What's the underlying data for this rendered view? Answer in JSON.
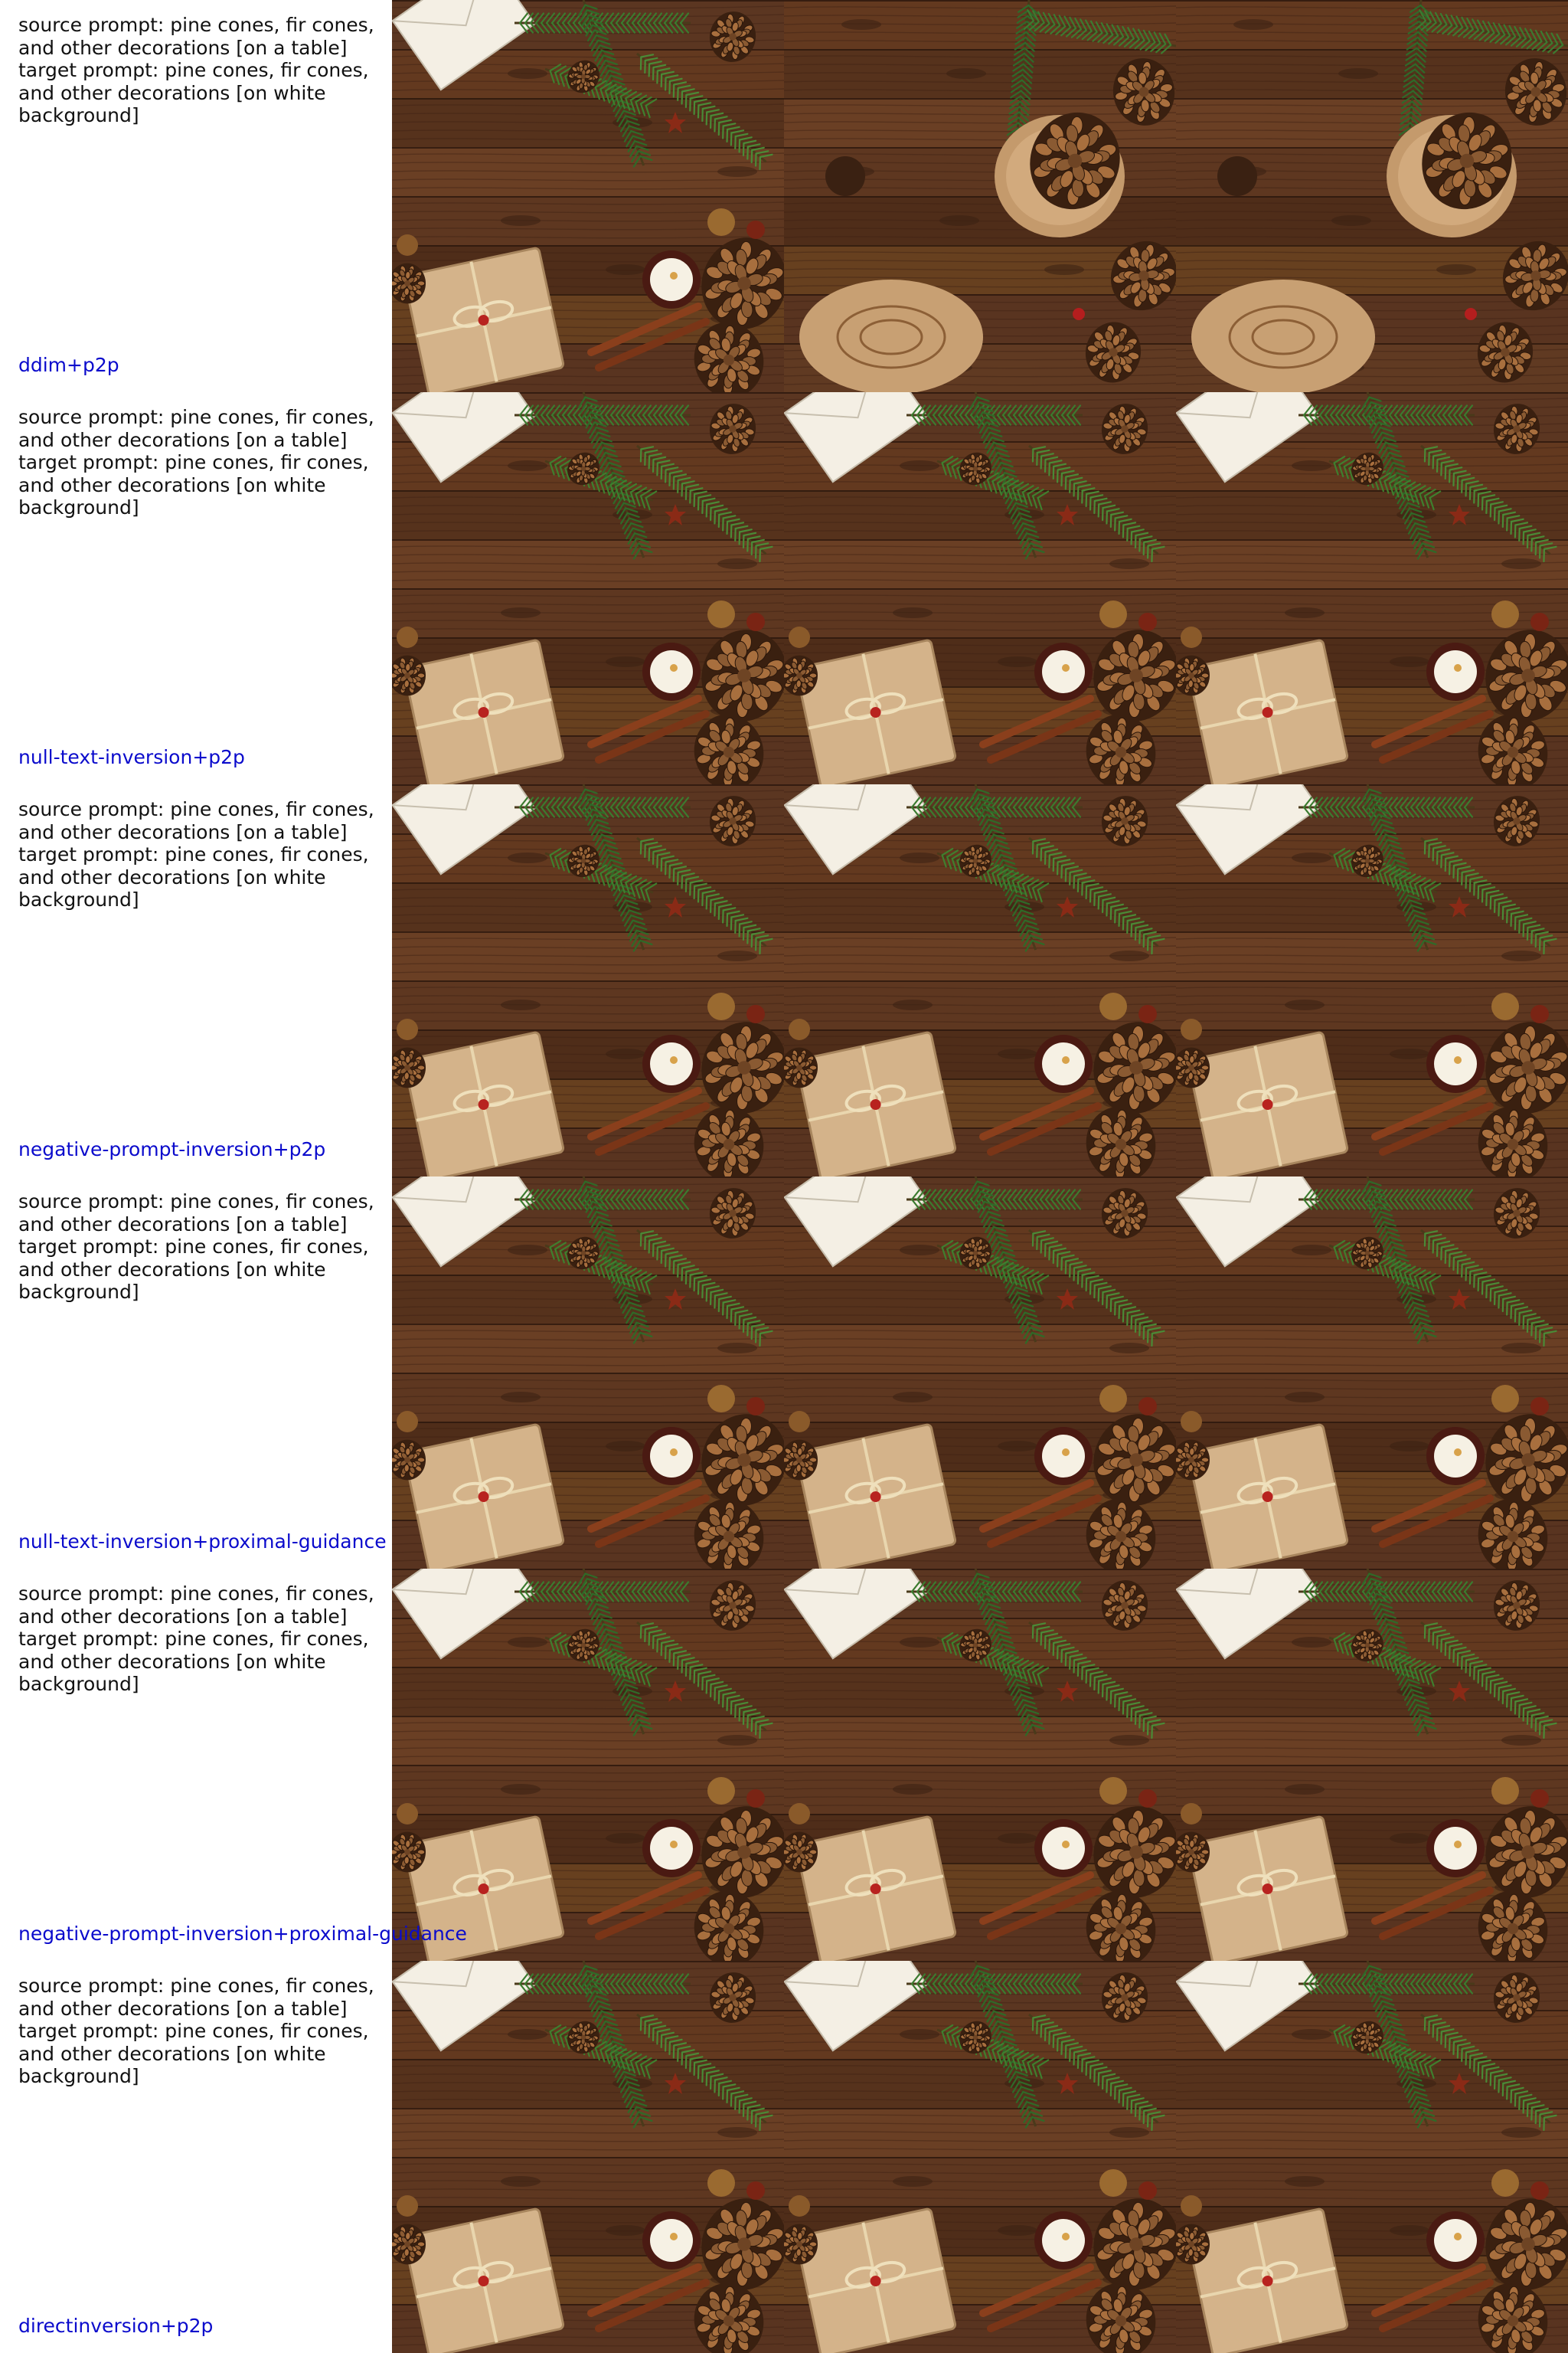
{
  "colors": {
    "method_label": "#0b0bcc",
    "prompt_text": "#111111",
    "background": "#ffffff"
  },
  "rows": [
    {
      "prompt": "source prompt: pine cones, fir cones,\nand other decorations [on a table]\ntarget prompt: pine cones, fir cones,\nand other decorations [on white\nbackground]",
      "method": "ddim+p2p"
    },
    {
      "prompt": "source prompt: pine cones, fir cones,\nand other decorations [on a table]\ntarget prompt: pine cones, fir cones,\nand other decorations [on white\nbackground]",
      "method": "null-text-inversion+p2p"
    },
    {
      "prompt": "source prompt: pine cones, fir cones,\nand other decorations [on a table]\ntarget prompt: pine cones, fir cones,\nand other decorations [on white\nbackground]",
      "method": "negative-prompt-inversion+p2p"
    },
    {
      "prompt": "source prompt: pine cones, fir cones,\nand other decorations [on a table]\ntarget prompt: pine cones, fir cones,\nand other decorations [on white\nbackground]",
      "method": "null-text-inversion+proximal-guidance"
    },
    {
      "prompt": "source prompt: pine cones, fir cones,\nand other decorations [on a table]\ntarget prompt: pine cones, fir cones,\nand other decorations [on white\nbackground]",
      "method": "negative-prompt-inversion+proximal-guidance"
    },
    {
      "prompt": "source prompt: pine cones, fir cones,\nand other decorations [on a table]\ntarget prompt: pine cones, fir cones,\nand other decorations [on white\nbackground]",
      "method": "directinversion+p2p"
    }
  ],
  "images": {
    "columns": [
      "source-image",
      "reconstruction-image",
      "edited-image"
    ]
  }
}
